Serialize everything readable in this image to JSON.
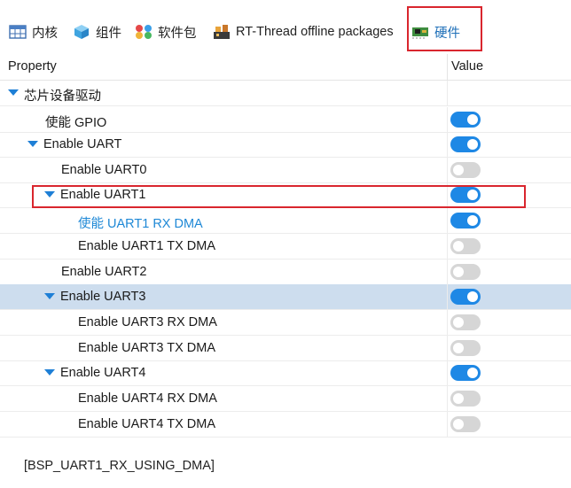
{
  "tabs": [
    {
      "label": "内核",
      "icon": "table-grid-icon"
    },
    {
      "label": "组件",
      "icon": "cube-icon"
    },
    {
      "label": "软件包",
      "icon": "packages-icon"
    },
    {
      "label": "RT-Thread offline packages",
      "icon": "offline-packages-icon"
    },
    {
      "label": "硬件",
      "icon": "hardware-board-icon"
    }
  ],
  "header": {
    "property": "Property",
    "value": "Value"
  },
  "rows": [
    {
      "label": "芯片设备驱动",
      "caret": true,
      "state": null
    },
    {
      "label": "使能 GPIO",
      "caret": false,
      "state": "on"
    },
    {
      "label": "Enable UART",
      "caret": true,
      "state": "on"
    },
    {
      "label": "Enable UART0",
      "caret": false,
      "state": "off"
    },
    {
      "label": "Enable UART1",
      "caret": true,
      "state": "on"
    },
    {
      "label": "使能 UART1 RX DMA",
      "caret": false,
      "state": "on"
    },
    {
      "label": "Enable UART1 TX DMA",
      "caret": false,
      "state": "off"
    },
    {
      "label": "Enable UART2",
      "caret": false,
      "state": "off"
    },
    {
      "label": "Enable UART3",
      "caret": true,
      "state": "on"
    },
    {
      "label": "Enable UART3 RX DMA",
      "caret": false,
      "state": "off"
    },
    {
      "label": "Enable UART3 TX DMA",
      "caret": false,
      "state": "off"
    },
    {
      "label": "Enable UART4",
      "caret": true,
      "state": "on"
    },
    {
      "label": "Enable UART4 RX DMA",
      "caret": false,
      "state": "off"
    },
    {
      "label": "Enable UART4 TX DMA",
      "caret": false,
      "state": "off"
    }
  ],
  "footer": {
    "macro": "[BSP_UART1_RX_USING_DMA]"
  },
  "colors": {
    "accent": "#1e88e5",
    "highlight_border": "#d9262e",
    "selected_row": "#cdddee"
  }
}
